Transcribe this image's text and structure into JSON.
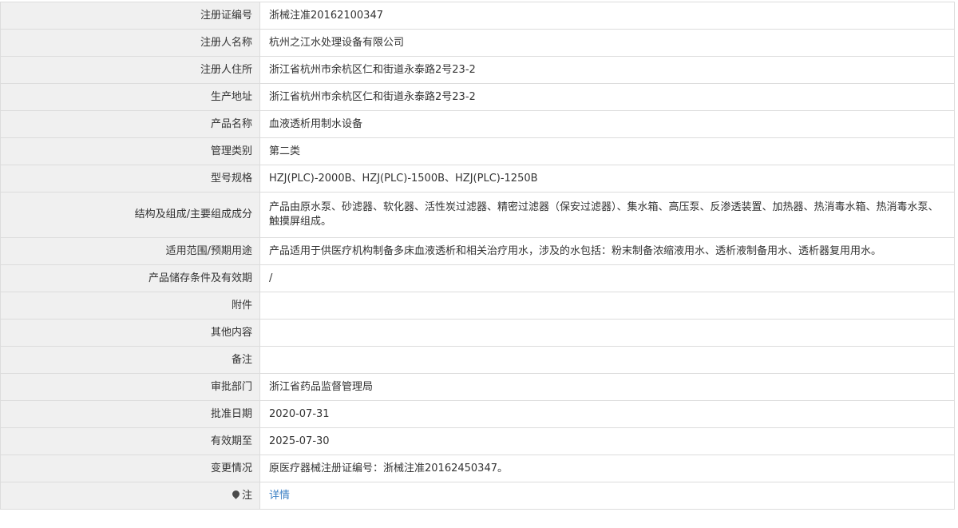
{
  "rows": [
    {
      "label": "注册证编号",
      "value": "浙械注准20162100347"
    },
    {
      "label": "注册人名称",
      "value": "杭州之江水处理设备有限公司"
    },
    {
      "label": "注册人住所",
      "value": "浙江省杭州市余杭区仁和街道永泰路2号23-2"
    },
    {
      "label": "生产地址",
      "value": "浙江省杭州市余杭区仁和街道永泰路2号23-2"
    },
    {
      "label": "产品名称",
      "value": "血液透析用制水设备"
    },
    {
      "label": "管理类别",
      "value": "第二类"
    },
    {
      "label": "型号规格",
      "value": "HZJ(PLC)-2000B、HZJ(PLC)-1500B、HZJ(PLC)-1250B"
    },
    {
      "label": "结构及组成/主要组成成分",
      "value": "产品由原水泵、砂滤器、软化器、活性炭过滤器、精密过滤器（保安过滤器）、集水箱、高压泵、反渗透装置、加热器、热消毒水箱、热消毒水泵、触摸屏组成。"
    },
    {
      "label": "适用范围/预期用途",
      "value": "产品适用于供医疗机构制备多床血液透析和相关治疗用水，涉及的水包括：粉末制备浓缩液用水、透析液制备用水、透析器复用用水。"
    },
    {
      "label": "产品储存条件及有效期",
      "value": "/"
    },
    {
      "label": "附件",
      "value": ""
    },
    {
      "label": "其他内容",
      "value": ""
    },
    {
      "label": "备注",
      "value": ""
    },
    {
      "label": "审批部门",
      "value": "浙江省药品监督管理局"
    },
    {
      "label": "批准日期",
      "value": "2020-07-31"
    },
    {
      "label": "有效期至",
      "value": "2025-07-30"
    },
    {
      "label": "变更情况",
      "value": "原医疗器械注册证编号：浙械注准20162450347。"
    }
  ],
  "note": {
    "icon": "map-pin-icon",
    "label": "注",
    "link_text": "详情",
    "link_color": "#3a7fc4"
  }
}
